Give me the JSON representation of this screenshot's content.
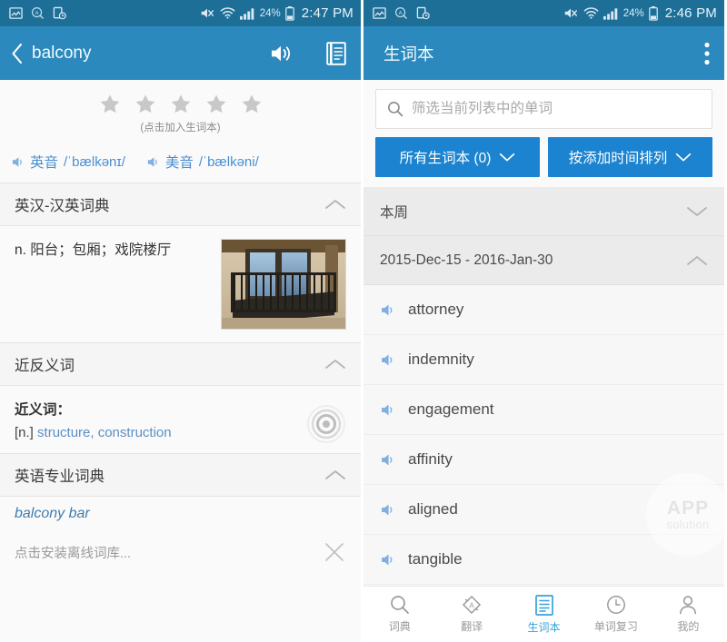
{
  "left": {
    "status_bar": {
      "icons": [
        "image-notification-icon",
        "magnifier-a-icon",
        "device-clock-icon"
      ],
      "signal": "signal-bars-icon",
      "wifi": "wifi-icon",
      "mute": "mute-icon",
      "battery_percent": "24%",
      "time": "2:47 PM"
    },
    "toolbar": {
      "back_icon": "back-chevron-icon",
      "title": "balcony",
      "speaker_icon": "speaker-icon",
      "notebook_icon": "notebook-icon"
    },
    "rating": {
      "star_count": 5,
      "hint": "(点击加入生词本)"
    },
    "phonetics": [
      {
        "label": "英音",
        "ipa": "/ˈbælkənɪ/",
        "icon": "speaker-small-icon"
      },
      {
        "label": "美音",
        "ipa": "/ˈbælkəni/",
        "icon": "speaker-small-icon"
      }
    ],
    "sections": [
      {
        "title": "英汉-汉英词典",
        "collapse_icon": "chevron-up-icon",
        "definition": "n. 阳台；包厢；戏院楼厅",
        "image_alt": "balcony-photo"
      },
      {
        "title": "近反义词",
        "collapse_icon": "chevron-up-icon",
        "syn_label": "近义词：",
        "syn_pos": "[n.]",
        "syn_words": "structure, construction",
        "target_icon": "target-circles-icon"
      },
      {
        "title": "英语专业词典",
        "collapse_icon": "chevron-up-icon",
        "term": "balcony bar"
      }
    ],
    "install": {
      "text": "点击安装离线词库...",
      "close_icon": "close-x-icon"
    }
  },
  "right": {
    "status_bar": {
      "icons": [
        "image-notification-icon",
        "magnifier-a-icon",
        "device-clock-icon"
      ],
      "battery_percent": "24%",
      "time": "2:46 PM"
    },
    "toolbar": {
      "title": "生词本",
      "overflow_icon": "overflow-menu-icon"
    },
    "search": {
      "icon": "search-icon",
      "placeholder": "筛选当前列表中的单词",
      "value": ""
    },
    "dropdowns": [
      {
        "label": "所有生词本 (0)",
        "icon": "chevron-down-icon"
      },
      {
        "label": "按添加时间排列",
        "icon": "chevron-down-icon"
      }
    ],
    "groups": [
      {
        "title": "本周",
        "icon": "chevron-down-icon",
        "expanded": false,
        "words": []
      },
      {
        "title": "2015-Dec-15 - 2016-Jan-30",
        "icon": "chevron-up-icon",
        "expanded": true,
        "words": [
          "attorney",
          "indemnity",
          "engagement",
          "affinity",
          "aligned",
          "tangible"
        ]
      }
    ],
    "watermark": {
      "line1": "APP",
      "line2": "solution"
    },
    "bottom_nav": [
      {
        "label": "词典",
        "icon": "search-icon",
        "active": false
      },
      {
        "label": "翻译",
        "icon": "translate-icon",
        "active": false
      },
      {
        "label": "生词本",
        "icon": "notebook-icon",
        "active": true
      },
      {
        "label": "单词复习",
        "icon": "clock-icon",
        "active": false
      },
      {
        "label": "我的",
        "icon": "person-icon",
        "active": false
      }
    ]
  },
  "colors": {
    "statusbar": "#1d6f98",
    "toolbar": "#2b89bd",
    "dropdown": "#1b83cf",
    "accent": "#36a3d9",
    "link": "#5b8fc4"
  }
}
